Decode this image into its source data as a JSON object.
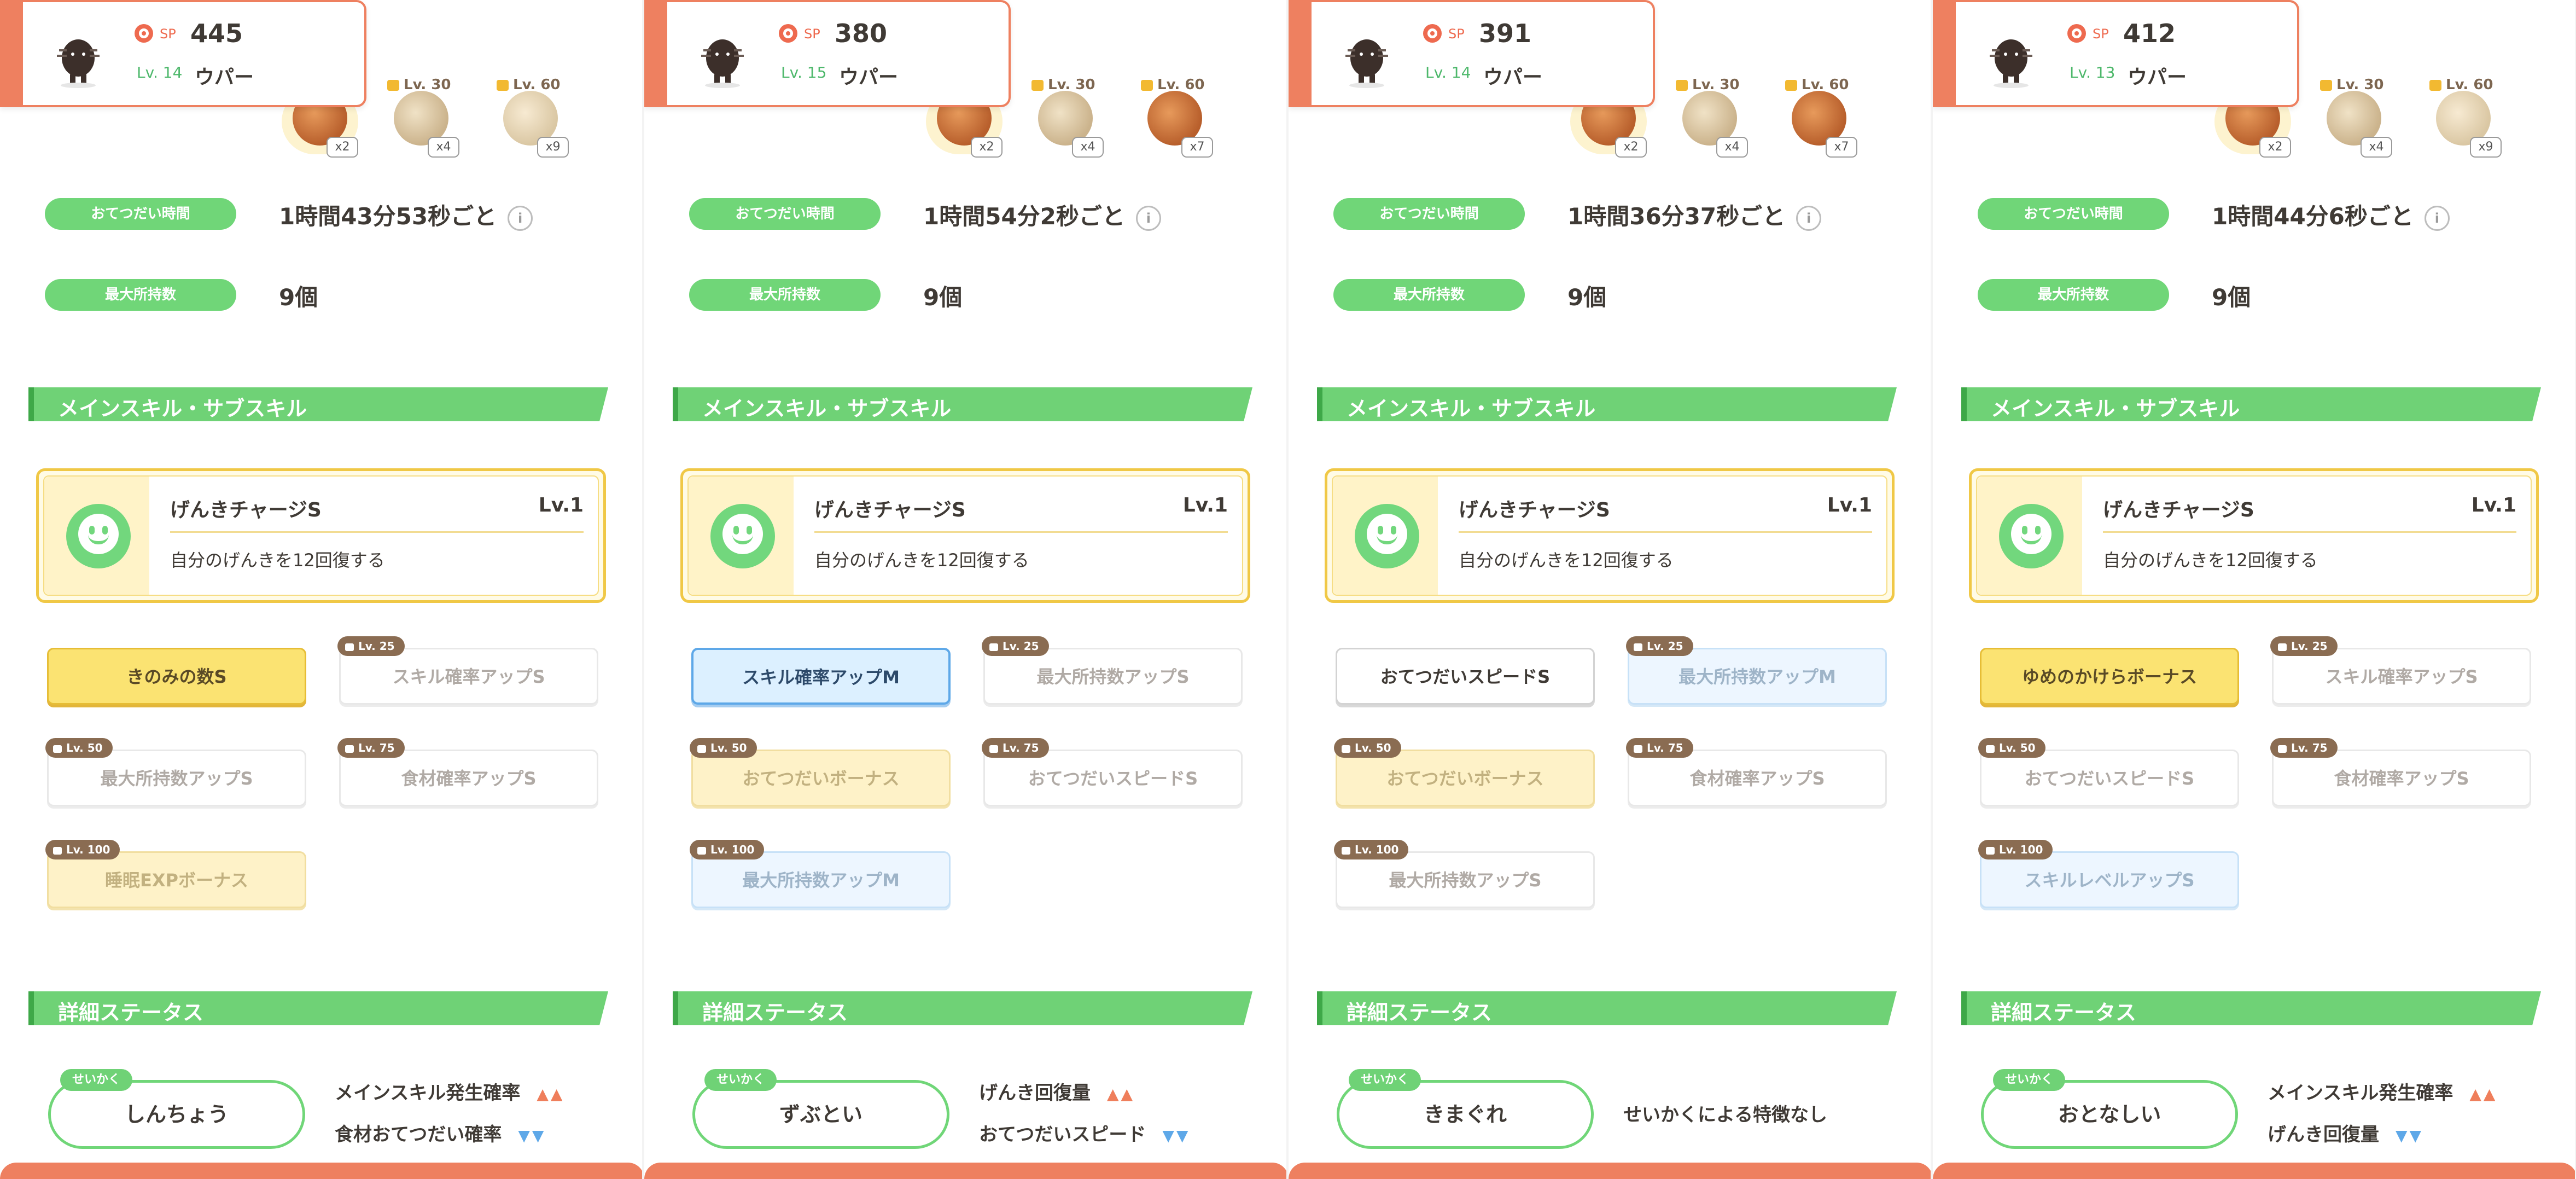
{
  "common": {
    "sp_label": "SP",
    "stat_help_time": "おてつだい時間",
    "stat_max_carry": "最大所持数",
    "section_skills": "メインスキル・サブスキル",
    "section_details": "詳細ステータス",
    "main_skill_name": "げんきチャージS",
    "main_skill_level": "Lv.1",
    "main_skill_desc": "自分のげんきを12回復する",
    "nature_tag": "せいかく",
    "info_icon": "i",
    "ingredient_lock_levels": [
      "Lv. 30",
      "Lv. 60"
    ],
    "subskill_lock_labels": [
      "Lv. 25",
      "Lv. 50",
      "Lv. 75",
      "Lv. 100"
    ],
    "colors": {
      "accent": "#ee8060",
      "green": "#6fd276",
      "gold": "#f0c846",
      "blue": "#5ea8e8"
    }
  },
  "panels": [
    {
      "sp": "445",
      "level": "Lv. 14",
      "name": "ウパー",
      "ingredients": [
        {
          "kind": "cacao",
          "count": "x2"
        },
        {
          "kind": "bean",
          "count": "x4"
        },
        {
          "kind": "potato",
          "count": "x9"
        }
      ],
      "help_time": "1時間43分53秒ごと",
      "max_carry": "9個",
      "subskills": [
        {
          "label": "きのみの数S",
          "style": "gold"
        },
        {
          "label": "スキル確率アップS",
          "style": "white-dim"
        },
        {
          "label": "最大所持数アップS",
          "style": "white-dim"
        },
        {
          "label": "食材確率アップS",
          "style": "white-dim"
        },
        {
          "label": "睡眠EXPボーナス",
          "style": "gold-dim"
        }
      ],
      "nature": "しんちょう",
      "effects": [
        {
          "text": "メインスキル発生確率",
          "arrow": "▲▲",
          "dir": "up"
        },
        {
          "text": "食材おてつだい確率",
          "arrow": "▼▼",
          "dir": "down"
        }
      ]
    },
    {
      "sp": "380",
      "level": "Lv. 15",
      "name": "ウパー",
      "ingredients": [
        {
          "kind": "cacao",
          "count": "x2"
        },
        {
          "kind": "bean",
          "count": "x4"
        },
        {
          "kind": "cacao",
          "count": "x7"
        }
      ],
      "help_time": "1時間54分2秒ごと",
      "max_carry": "9個",
      "subskills": [
        {
          "label": "スキル確率アップM",
          "style": "blue"
        },
        {
          "label": "最大所持数アップS",
          "style": "white-dim"
        },
        {
          "label": "おてつだいボーナス",
          "style": "gold-dim"
        },
        {
          "label": "おてつだいスピードS",
          "style": "white-dim"
        },
        {
          "label": "最大所持数アップM",
          "style": "blue-dim"
        }
      ],
      "nature": "ずぶとい",
      "effects": [
        {
          "text": "げんき回復量",
          "arrow": "▲▲",
          "dir": "up"
        },
        {
          "text": "おてつだいスピード",
          "arrow": "▼▼",
          "dir": "down"
        }
      ]
    },
    {
      "sp": "391",
      "level": "Lv. 14",
      "name": "ウパー",
      "ingredients": [
        {
          "kind": "cacao",
          "count": "x2"
        },
        {
          "kind": "bean",
          "count": "x4"
        },
        {
          "kind": "cacao",
          "count": "x7"
        }
      ],
      "help_time": "1時間36分37秒ごと",
      "max_carry": "9個",
      "subskills": [
        {
          "label": "おてつだいスピードS",
          "style": "white"
        },
        {
          "label": "最大所持数アップM",
          "style": "blue-dim"
        },
        {
          "label": "おてつだいボーナス",
          "style": "gold-dim"
        },
        {
          "label": "食材確率アップS",
          "style": "white-dim"
        },
        {
          "label": "最大所持数アップS",
          "style": "white-dim"
        }
      ],
      "nature": "きまぐれ",
      "effects": [
        {
          "text": "せいかくによる特徴なし",
          "arrow": "",
          "dir": "none"
        }
      ]
    },
    {
      "sp": "412",
      "level": "Lv. 13",
      "name": "ウパー",
      "ingredients": [
        {
          "kind": "cacao",
          "count": "x2"
        },
        {
          "kind": "bean",
          "count": "x4"
        },
        {
          "kind": "potato",
          "count": "x9"
        }
      ],
      "help_time": "1時間44分6秒ごと",
      "max_carry": "9個",
      "subskills": [
        {
          "label": "ゆめのかけらボーナス",
          "style": "gold"
        },
        {
          "label": "スキル確率アップS",
          "style": "white-dim"
        },
        {
          "label": "おてつだいスピードS",
          "style": "white-dim"
        },
        {
          "label": "食材確率アップS",
          "style": "white-dim"
        },
        {
          "label": "スキルレベルアップS",
          "style": "blue-dim"
        }
      ],
      "nature": "おとなしい",
      "effects": [
        {
          "text": "メインスキル発生確率",
          "arrow": "▲▲",
          "dir": "up"
        },
        {
          "text": "げんき回復量",
          "arrow": "▼▼",
          "dir": "down"
        }
      ]
    }
  ]
}
